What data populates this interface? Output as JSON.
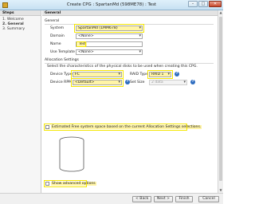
{
  "window": {
    "title": "Create CPG : SpartanMd (598ME78) : Test"
  },
  "steps": {
    "header": "Steps",
    "items": [
      {
        "label": "1. Welcome"
      },
      {
        "label": "2. General"
      },
      {
        "label": "3. Summary"
      }
    ]
  },
  "general": {
    "header": "General",
    "section_label": "General",
    "system": {
      "label": "System",
      "value": "SpartanMd (1MM678)"
    },
    "domain": {
      "label": "Domain",
      "value": "<None>"
    },
    "name": {
      "label": "Name",
      "value": "Test"
    },
    "user_template": {
      "label": "Use Template",
      "value": "<None>"
    }
  },
  "allocation": {
    "section_label": "Allocation Settings",
    "description": "Select the characteristics of the physical disks to be used when creating this CPG.",
    "device_type": {
      "label": "Device Type",
      "value": "FC"
    },
    "raid_type": {
      "label": "RAID Type",
      "value": "RAID 1"
    },
    "device_rpm": {
      "label": "Device RPM",
      "value": "<Default>"
    },
    "set_size": {
      "label": "Set Size",
      "value": "2 data"
    }
  },
  "estimate": {
    "label": "Estimated Free system space based on the current Allocation Settings selections."
  },
  "advanced": {
    "label": "Show advanced options"
  },
  "footer": {
    "back": "< Back",
    "next": "Next >",
    "finish": "Finish",
    "cancel": "Cancel"
  }
}
